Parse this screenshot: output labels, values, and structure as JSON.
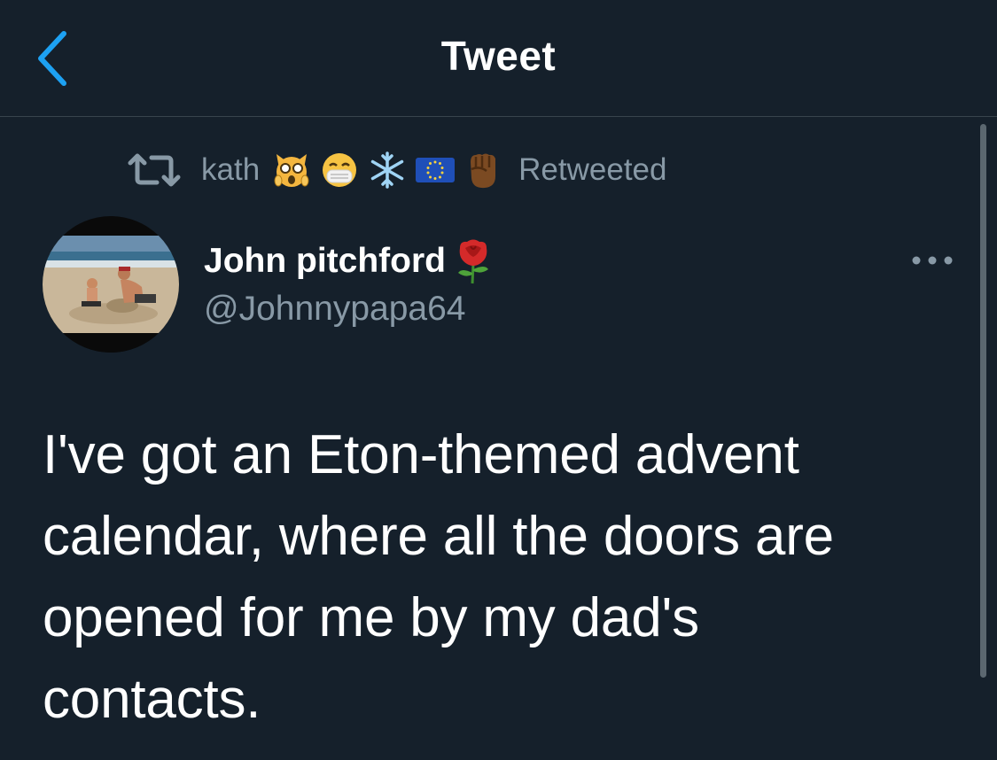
{
  "header": {
    "title": "Tweet",
    "back_icon": "chevron-left-icon",
    "accent_color": "#1da1f2"
  },
  "retweet": {
    "icon": "retweet-icon",
    "user_name": "kath",
    "emojis": [
      "screaming-cat",
      "face-with-medical-mask",
      "snowflake",
      "eu-flag",
      "raised-fist-dark"
    ],
    "status": "Retweeted"
  },
  "author": {
    "name": "John pitchford",
    "name_emoji": "rose",
    "handle": "@Johnnypapa64",
    "avatar": "beach-sandcastle-photo"
  },
  "tweet": {
    "text": "I've got an Eton-themed advent calendar, where all the doors are opened for me by my dad's contacts."
  },
  "theme": {
    "background": "#15202b",
    "muted_text": "#8899a6",
    "divider": "#38444d"
  }
}
